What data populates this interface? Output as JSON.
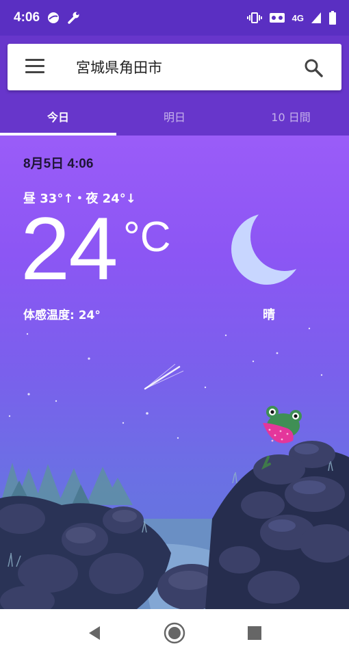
{
  "status_bar": {
    "time": "4:06",
    "network": "4G"
  },
  "search": {
    "location": "宮城県角田市"
  },
  "tabs": [
    {
      "label": "今日",
      "active": true
    },
    {
      "label": "明日",
      "active": false
    },
    {
      "label": "10 日間",
      "active": false
    }
  ],
  "weather": {
    "datetime": "8月5日 4:06",
    "hi_lo": "昼 33°↑・夜 24°↓",
    "temperature": "24",
    "unit": "°C",
    "feels_like": "体感温度: 24°",
    "condition": "晴",
    "condition_icon": "crescent-moon-icon"
  },
  "colors": {
    "status_bar": "#5a2fc2",
    "header": "#6736cb",
    "moon": "#c8d6ff"
  },
  "nav": {
    "back_icon": "back-triangle-icon",
    "home_icon": "home-circle-icon",
    "recents_icon": "recents-square-icon"
  }
}
